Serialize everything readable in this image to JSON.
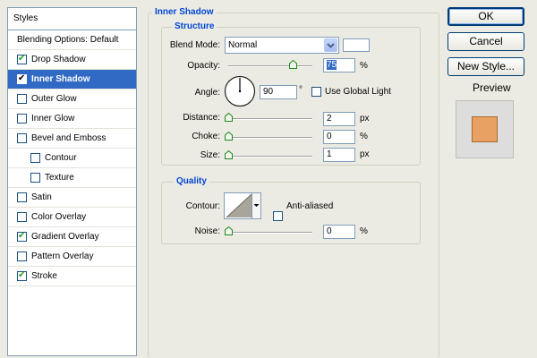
{
  "styles_header": "Styles",
  "style_items": [
    {
      "label": "Blending Options: Default",
      "checkbox": false,
      "checked": false,
      "selected": false,
      "indent": false
    },
    {
      "label": "Drop Shadow",
      "checkbox": true,
      "checked": true,
      "selected": false,
      "indent": false
    },
    {
      "label": "Inner Shadow",
      "checkbox": true,
      "checked": true,
      "selected": true,
      "indent": false
    },
    {
      "label": "Outer Glow",
      "checkbox": true,
      "checked": false,
      "selected": false,
      "indent": false
    },
    {
      "label": "Inner Glow",
      "checkbox": true,
      "checked": false,
      "selected": false,
      "indent": false
    },
    {
      "label": "Bevel and Emboss",
      "checkbox": true,
      "checked": false,
      "selected": false,
      "indent": false
    },
    {
      "label": "Contour",
      "checkbox": true,
      "checked": false,
      "selected": false,
      "indent": true
    },
    {
      "label": "Texture",
      "checkbox": true,
      "checked": false,
      "selected": false,
      "indent": true
    },
    {
      "label": "Satin",
      "checkbox": true,
      "checked": false,
      "selected": false,
      "indent": false
    },
    {
      "label": "Color Overlay",
      "checkbox": true,
      "checked": false,
      "selected": false,
      "indent": false
    },
    {
      "label": "Gradient Overlay",
      "checkbox": true,
      "checked": true,
      "selected": false,
      "indent": false
    },
    {
      "label": "Pattern Overlay",
      "checkbox": true,
      "checked": false,
      "selected": false,
      "indent": false
    },
    {
      "label": "Stroke",
      "checkbox": true,
      "checked": true,
      "selected": false,
      "indent": false
    }
  ],
  "panel": {
    "title": "Inner Shadow",
    "structure": {
      "title": "Structure",
      "blend_mode_label": "Blend Mode:",
      "blend_mode_value": "Normal",
      "blend_color": "#ffffff",
      "opacity_label": "Opacity:",
      "opacity_value": "75",
      "opacity_unit": "%",
      "angle_label": "Angle:",
      "angle_value": "90",
      "angle_unit": "°",
      "use_global_light_label": "Use Global Light",
      "use_global_light": false,
      "distance_label": "Distance:",
      "distance_value": "2",
      "distance_unit": "px",
      "choke_label": "Choke:",
      "choke_value": "0",
      "choke_unit": "%",
      "size_label": "Size:",
      "size_value": "1",
      "size_unit": "px"
    },
    "quality": {
      "title": "Quality",
      "contour_label": "Contour:",
      "anti_aliased_label": "Anti-aliased",
      "anti_aliased": false,
      "noise_label": "Noise:",
      "noise_value": "0",
      "noise_unit": "%"
    }
  },
  "buttons": {
    "ok": "OK",
    "cancel": "Cancel",
    "new_style": "New Style..."
  },
  "preview": {
    "label": "Preview",
    "checked": true,
    "swatch_color": "#e8a162"
  },
  "colors": {
    "accent": "#0046d5",
    "selection": "#316ac5",
    "check_green": "#21a121"
  }
}
